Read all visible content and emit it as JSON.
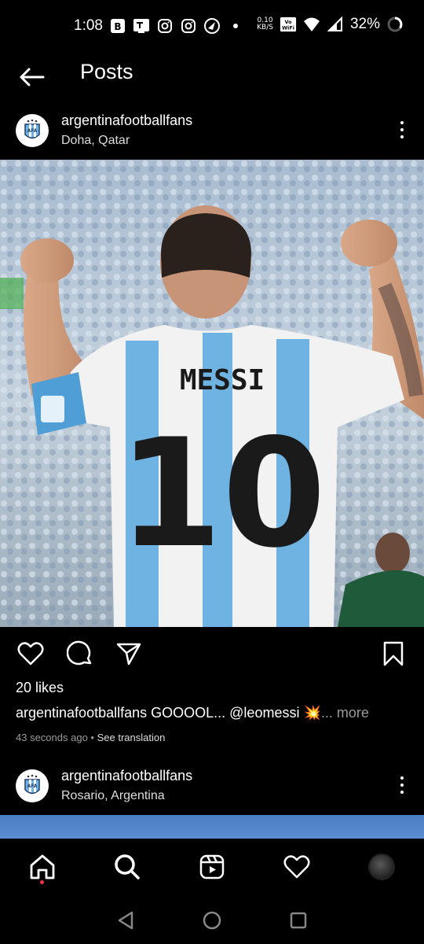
{
  "status_bar": {
    "time": "1:08",
    "net_speed_value": "0.10",
    "net_speed_unit": "KB/S",
    "battery": "32%",
    "icons": [
      "b-app-icon",
      "tv-app-icon",
      "instagram-icon",
      "instagram-icon",
      "hotstar-icon",
      "dot-icon",
      "volte-wifi-icon",
      "wifi-icon",
      "signal-icon",
      "battery-icon"
    ]
  },
  "header": {
    "title": "Posts"
  },
  "posts": [
    {
      "username": "argentinafootballfans",
      "location": "Doha, Qatar",
      "likes": "20 likes",
      "caption_user": "argentinafootballfans",
      "caption_text": "GOOOOL... @leomessi 💥",
      "caption_more": "... more",
      "time_ago": "43 seconds ago",
      "separator": "•",
      "see_translation": "See translation",
      "jersey_name": "MESSI",
      "jersey_number": "10"
    },
    {
      "username": "argentinafootballfans",
      "location": "Rosario, Argentina"
    }
  ],
  "colors": {
    "background": "#000000",
    "muted_text": "#9a9a9a",
    "notification_dot": "#ff3040",
    "jersey_blue": "#6fb3e3"
  }
}
